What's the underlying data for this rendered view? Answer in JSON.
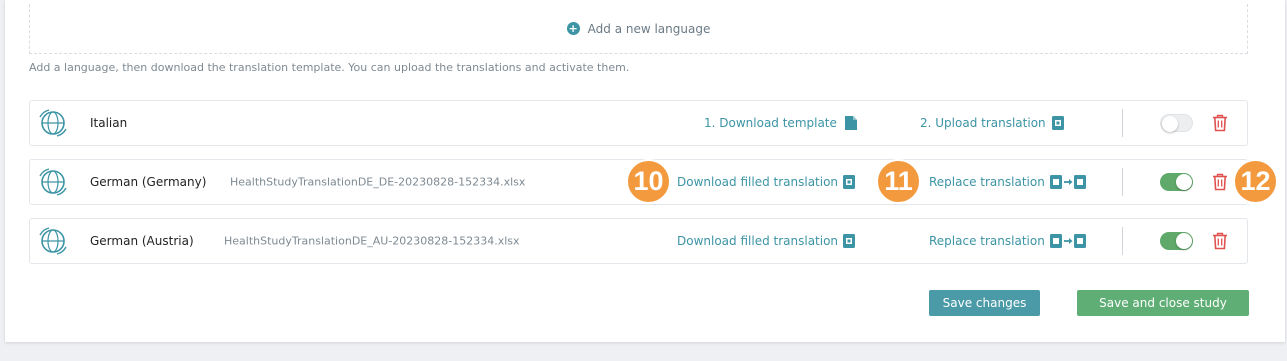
{
  "add_language": {
    "label": "Add a new language"
  },
  "hint": "Add a language, then download the translation template. You can upload the translations and activate them.",
  "rows": [
    {
      "language": "Italian",
      "filename": "",
      "download_label": "1. Download template",
      "upload_label": "2. Upload translation",
      "active": false
    },
    {
      "language": "German (Germany)",
      "filename": "HealthStudyTranslationDE_DE-20230828-152334.xlsx",
      "download_label": "Download filled translation",
      "upload_label": "Replace translation",
      "active": true
    },
    {
      "language": "German (Austria)",
      "filename": "HealthStudyTranslationDE_AU-20230828-152334.xlsx",
      "download_label": "Download filled translation",
      "upload_label": "Replace translation",
      "active": true
    }
  ],
  "badges": [
    "10",
    "11",
    "12"
  ],
  "buttons": {
    "save": "Save changes",
    "save_close": "Save and close study"
  },
  "colors": {
    "accent": "#3c94a5",
    "toggle_on": "#5fa96a",
    "delete": "#e0524f",
    "badge": "#f39a3e",
    "save_button": "#4a9aa8",
    "save_close_button": "#5fae75"
  }
}
